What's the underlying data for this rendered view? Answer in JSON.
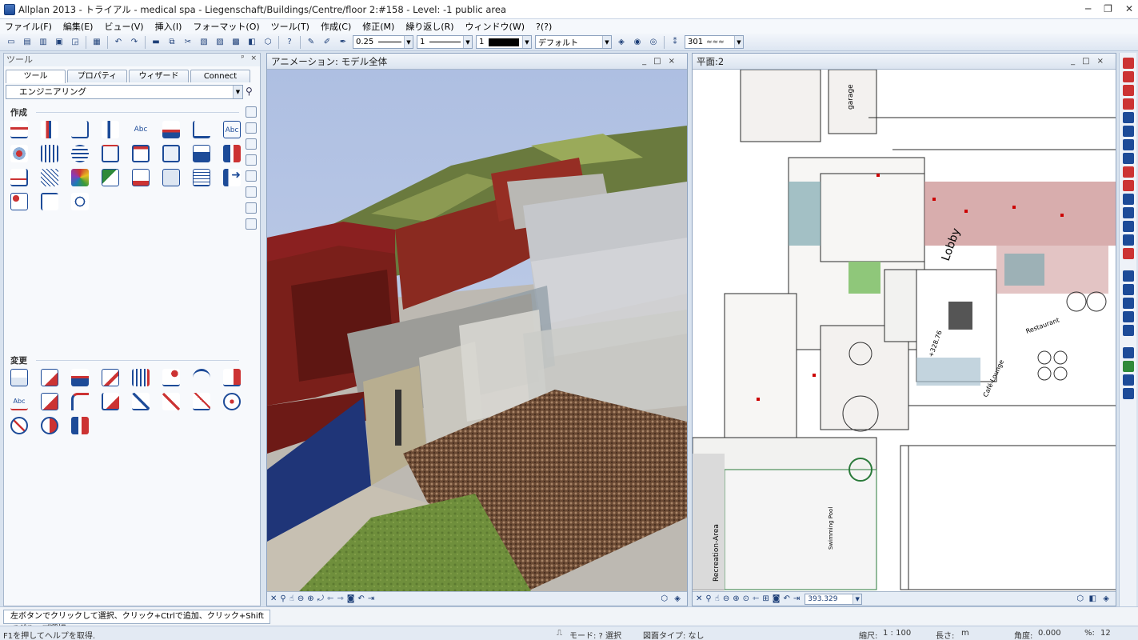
{
  "window": {
    "title": "Allplan 2013 - トライアル - medical spa - Liegenschaft/Buildings/Centre/floor 2:#158 - Level:  -1 public area"
  },
  "menu": [
    "ファイル(F)",
    "編集(E)",
    "ビュー(V)",
    "挿入(I)",
    "フォーマット(O)",
    "ツール(T)",
    "作成(C)",
    "修正(M)",
    "繰り返し(R)",
    "ウィンドウ(W)",
    "?(?)"
  ],
  "toolbar": {
    "pen_value": "0.25",
    "line_value": "1",
    "color_value": "1",
    "layer_value": "デフォルト",
    "pattern_value": "301"
  },
  "palette": {
    "title": "ツール",
    "pin": "ᵖ",
    "close": "×",
    "tabs": [
      "ツール",
      "プロパティ",
      "ウィザード",
      "Connect"
    ],
    "category": "エンジニアリング",
    "section_create": "作成",
    "section_modify": "変更"
  },
  "view3d": {
    "title": "アニメーション: モデル全体",
    "controls": "_□×"
  },
  "viewplan": {
    "title": "平面:2",
    "controls": "_□×",
    "coord_value": "393.329"
  },
  "plan_labels": {
    "lobby": "Lobby",
    "café": "Café-Lounge",
    "recreation": "Recreation-Area",
    "restaurant": "Restaurant",
    "pool": "Swimming Pool",
    "level": "+328.76",
    "garage": "garage"
  },
  "hint": "左ボタンでクリックして選択、クリック+Ctrlで追加、クリック+Shiftでグループ選択",
  "status": {
    "help": "F1を押してヘルプを取得.",
    "mode_label": "モード: ? 選択",
    "drawing_type": "図面タイプ: なし",
    "scale_label": "縮尺:",
    "scale_value": "1 : 100",
    "length_label": "長さ:",
    "length_value": "m",
    "angle_label": "角度:",
    "angle_value": "0.000",
    "percent_label": "%:",
    "percent_value": "12"
  },
  "colors": {
    "accent": "#2a5aa8",
    "wall_red": "#7a1f1a",
    "plan_pink": "#c78a8a",
    "plan_teal": "#7faab0",
    "lawn": "#6f8f3c"
  }
}
